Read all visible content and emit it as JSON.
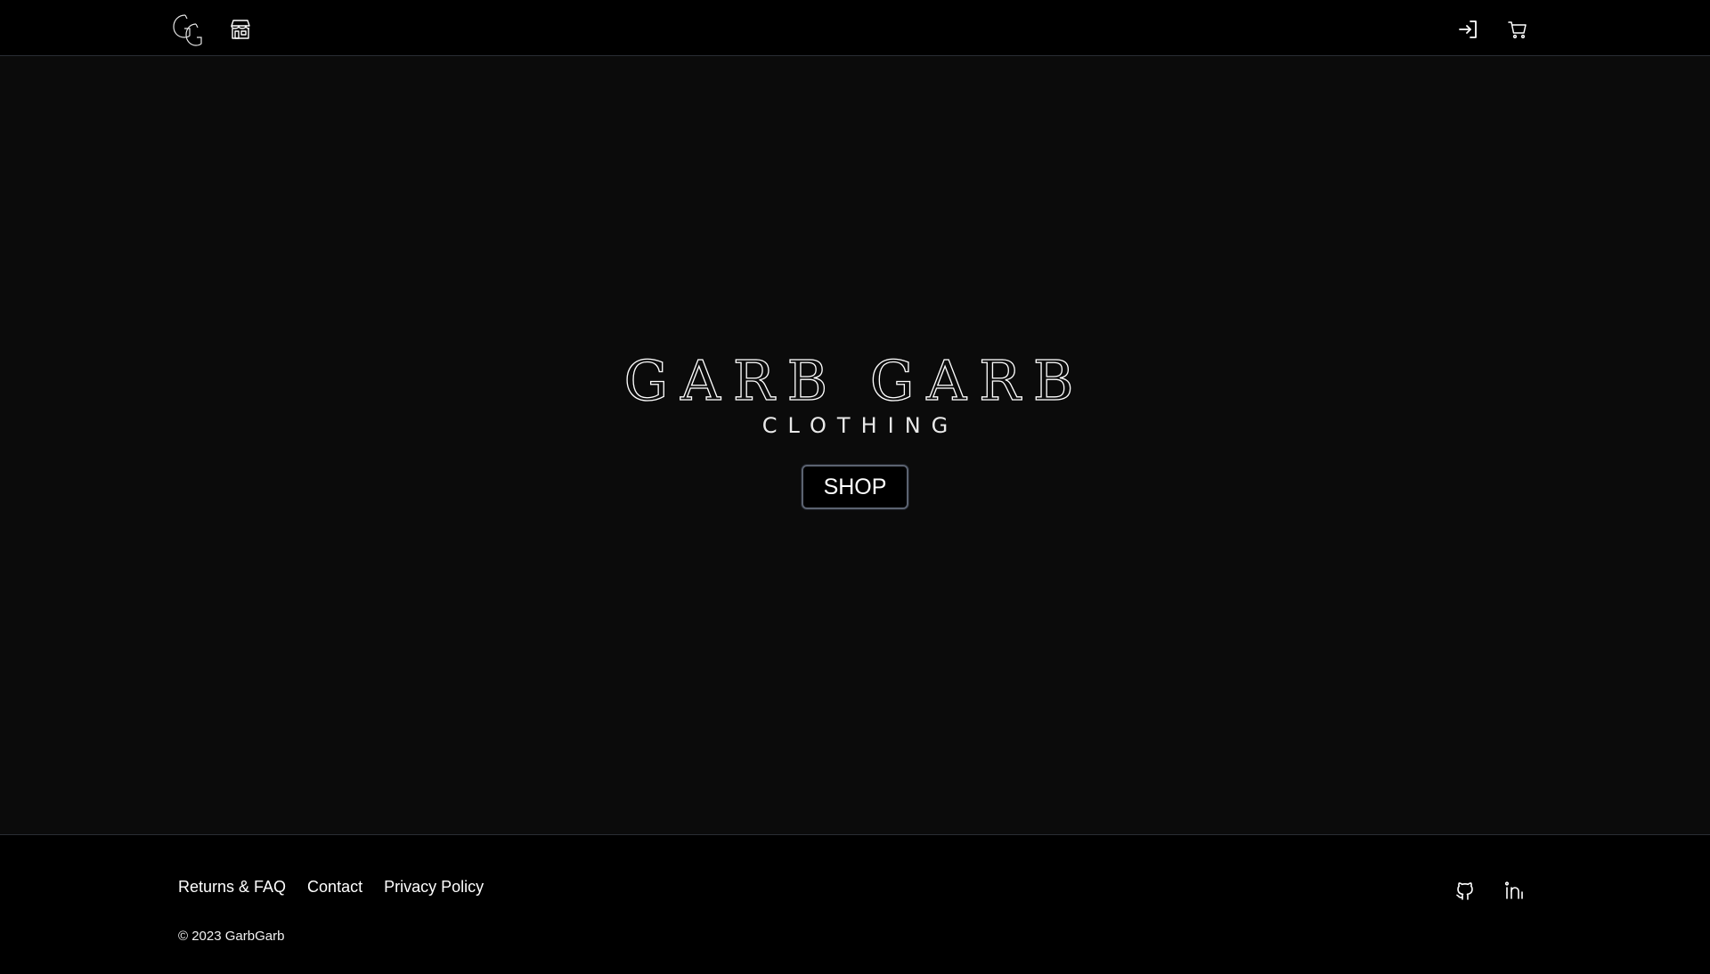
{
  "header": {
    "logo_icon": "gg-monogram-icon",
    "store_icon": "storefront-icon",
    "login_icon": "sign-in-icon",
    "cart_icon": "shopping-cart-icon"
  },
  "hero": {
    "brand_name": "GARB GARB",
    "tagline": "CLOTHING",
    "shop_label": "SHOP"
  },
  "footer": {
    "links": [
      "Returns & FAQ",
      "Contact",
      "Privacy Policy"
    ],
    "copyright": "© 2023 GarbGarb",
    "github_icon": "github-icon",
    "linkedin_icon": "linkedin-icon"
  },
  "colors": {
    "header_bg": "#000000",
    "hero_bg": "#0b0b0b",
    "footer_bg": "#000000",
    "border": "#2a2d34",
    "button_border": "#5b6270",
    "text": "#ffffff"
  }
}
